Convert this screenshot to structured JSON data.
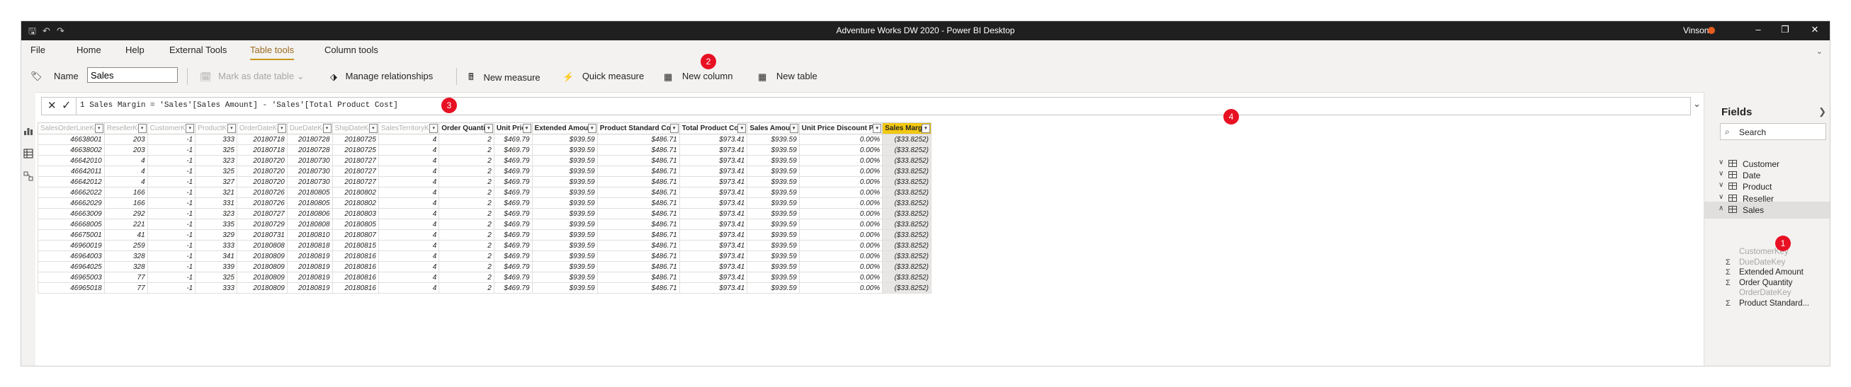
{
  "window": {
    "title": "Adventure Works DW 2020 - Power BI Desktop",
    "user": "Vinson"
  },
  "menu": {
    "items": [
      "File",
      "Home",
      "Help",
      "External Tools",
      "Table tools",
      "Column tools"
    ],
    "active": "Table tools"
  },
  "ribbon": {
    "name_label": "Name",
    "name_value": "Sales",
    "mark_date_table": "Mark as date table",
    "manage_relationships": "Manage relationships",
    "new_measure": "New measure",
    "quick_measure": "Quick measure",
    "new_column": "New column",
    "new_table": "New table"
  },
  "formula": {
    "line": "1",
    "text": "Sales Margin = 'Sales'[Sales Amount] - 'Sales'[Total Product Cost]"
  },
  "annotations": [
    "1",
    "2",
    "3",
    "4"
  ],
  "table": {
    "columns": [
      "SalesOrderLineKey",
      "ResellerKey",
      "CustomerKey",
      "ProductKey",
      "OrderDateKey",
      "DueDateKey",
      "ShipDateKey",
      "SalesTerritoryKey",
      "Order Quantity",
      "Unit Price",
      "Extended Amount",
      "Product Standard Cost",
      "Total Product Cost",
      "Sales Amount",
      "Unit Price Discount Pct",
      "Sales Margin"
    ],
    "rows": [
      [
        "46638001",
        "203",
        "-1",
        "333",
        "20180718",
        "20180728",
        "20180725",
        "4",
        "2",
        "$469.79",
        "$939.59",
        "$486.71",
        "$973.41",
        "$939.59",
        "0.00%",
        "($33.8252)"
      ],
      [
        "46638002",
        "203",
        "-1",
        "325",
        "20180718",
        "20180728",
        "20180725",
        "4",
        "2",
        "$469.79",
        "$939.59",
        "$486.71",
        "$973.41",
        "$939.59",
        "0.00%",
        "($33.8252)"
      ],
      [
        "46642010",
        "4",
        "-1",
        "323",
        "20180720",
        "20180730",
        "20180727",
        "4",
        "2",
        "$469.79",
        "$939.59",
        "$486.71",
        "$973.41",
        "$939.59",
        "0.00%",
        "($33.8252)"
      ],
      [
        "46642011",
        "4",
        "-1",
        "325",
        "20180720",
        "20180730",
        "20180727",
        "4",
        "2",
        "$469.79",
        "$939.59",
        "$486.71",
        "$973.41",
        "$939.59",
        "0.00%",
        "($33.8252)"
      ],
      [
        "46642012",
        "4",
        "-1",
        "327",
        "20180720",
        "20180730",
        "20180727",
        "4",
        "2",
        "$469.79",
        "$939.59",
        "$486.71",
        "$973.41",
        "$939.59",
        "0.00%",
        "($33.8252)"
      ],
      [
        "46662022",
        "166",
        "-1",
        "321",
        "20180726",
        "20180805",
        "20180802",
        "4",
        "2",
        "$469.79",
        "$939.59",
        "$486.71",
        "$973.41",
        "$939.59",
        "0.00%",
        "($33.8252)"
      ],
      [
        "46662029",
        "166",
        "-1",
        "331",
        "20180726",
        "20180805",
        "20180802",
        "4",
        "2",
        "$469.79",
        "$939.59",
        "$486.71",
        "$973.41",
        "$939.59",
        "0.00%",
        "($33.8252)"
      ],
      [
        "46663009",
        "292",
        "-1",
        "323",
        "20180727",
        "20180806",
        "20180803",
        "4",
        "2",
        "$469.79",
        "$939.59",
        "$486.71",
        "$973.41",
        "$939.59",
        "0.00%",
        "($33.8252)"
      ],
      [
        "46668005",
        "221",
        "-1",
        "335",
        "20180729",
        "20180808",
        "20180805",
        "4",
        "2",
        "$469.79",
        "$939.59",
        "$486.71",
        "$973.41",
        "$939.59",
        "0.00%",
        "($33.8252)"
      ],
      [
        "46675001",
        "41",
        "-1",
        "329",
        "20180731",
        "20180810",
        "20180807",
        "4",
        "2",
        "$469.79",
        "$939.59",
        "$486.71",
        "$973.41",
        "$939.59",
        "0.00%",
        "($33.8252)"
      ],
      [
        "46960019",
        "259",
        "-1",
        "333",
        "20180808",
        "20180818",
        "20180815",
        "4",
        "2",
        "$469.79",
        "$939.59",
        "$486.71",
        "$973.41",
        "$939.59",
        "0.00%",
        "($33.8252)"
      ],
      [
        "46964003",
        "328",
        "-1",
        "341",
        "20180809",
        "20180819",
        "20180816",
        "4",
        "2",
        "$469.79",
        "$939.59",
        "$486.71",
        "$973.41",
        "$939.59",
        "0.00%",
        "($33.8252)"
      ],
      [
        "46964025",
        "328",
        "-1",
        "339",
        "20180809",
        "20180819",
        "20180816",
        "4",
        "2",
        "$469.79",
        "$939.59",
        "$486.71",
        "$973.41",
        "$939.59",
        "0.00%",
        "($33.8252)"
      ],
      [
        "46965003",
        "77",
        "-1",
        "325",
        "20180809",
        "20180819",
        "20180816",
        "4",
        "2",
        "$469.79",
        "$939.59",
        "$486.71",
        "$973.41",
        "$939.59",
        "0.00%",
        "($33.8252)"
      ],
      [
        "46965018",
        "77",
        "-1",
        "333",
        "20180809",
        "20180819",
        "20180816",
        "4",
        "2",
        "$469.79",
        "$939.59",
        "$486.71",
        "$973.41",
        "$939.59",
        "0.00%",
        "($33.8252)"
      ]
    ]
  },
  "fields": {
    "title": "Fields",
    "search_placeholder": "Search",
    "tables": [
      "Customer",
      "Date",
      "Product",
      "Reseller",
      "Sales"
    ],
    "sales_fields": [
      {
        "label": "CustomerKey",
        "sigma": false,
        "dim": true
      },
      {
        "label": "DueDateKey",
        "sigma": true,
        "dim": true
      },
      {
        "label": "Extended Amount",
        "sigma": true,
        "dim": false
      },
      {
        "label": "Order Quantity",
        "sigma": true,
        "dim": false
      },
      {
        "label": "OrderDateKey",
        "sigma": false,
        "dim": true
      },
      {
        "label": "Product Standard...",
        "sigma": true,
        "dim": false
      }
    ]
  },
  "colors": {
    "accent": "#f2c811",
    "badge": "#e81123",
    "titlebar": "#1f1f1f"
  }
}
